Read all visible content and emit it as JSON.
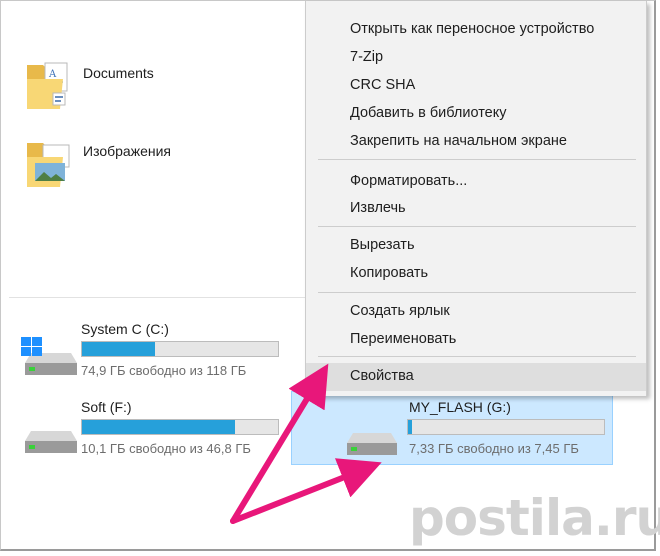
{
  "folders": [
    {
      "label": "Documents",
      "icon": "documents-folder-icon"
    },
    {
      "label": "Изображения",
      "icon": "pictures-folder-icon"
    }
  ],
  "drives": [
    {
      "name": "System C (C:)",
      "free": "74,9 ГБ свободно из 118 ГБ",
      "used_fraction": 0.37,
      "icon": "windows-drive-icon"
    },
    {
      "name": "Soft (F:)",
      "free": "10,1 ГБ свободно из 46,8 ГБ",
      "used_fraction": 0.78,
      "icon": "hard-drive-icon"
    },
    {
      "name": "MY_FLASH (G:)",
      "free": "7,33 ГБ свободно из 7,45 ГБ",
      "used_fraction": 0.02,
      "icon": "usb-drive-icon",
      "selected": true
    }
  ],
  "context_menu": {
    "items": [
      "Открыть как переносное устройство",
      "7-Zip",
      "CRC SHA",
      "Добавить в библиотеку",
      "Закрепить на начальном экране",
      "Форматировать...",
      "Извлечь",
      "Вырезать",
      "Копировать",
      "Создать ярлык",
      "Переименовать",
      "Свойства"
    ],
    "highlighted": "Свойства"
  },
  "watermark": "postila.ru",
  "colors": {
    "accent": "#26a0da",
    "selection": "#cce8ff",
    "arrow": "#e8177a",
    "menu_bg": "#f2f2f2"
  }
}
